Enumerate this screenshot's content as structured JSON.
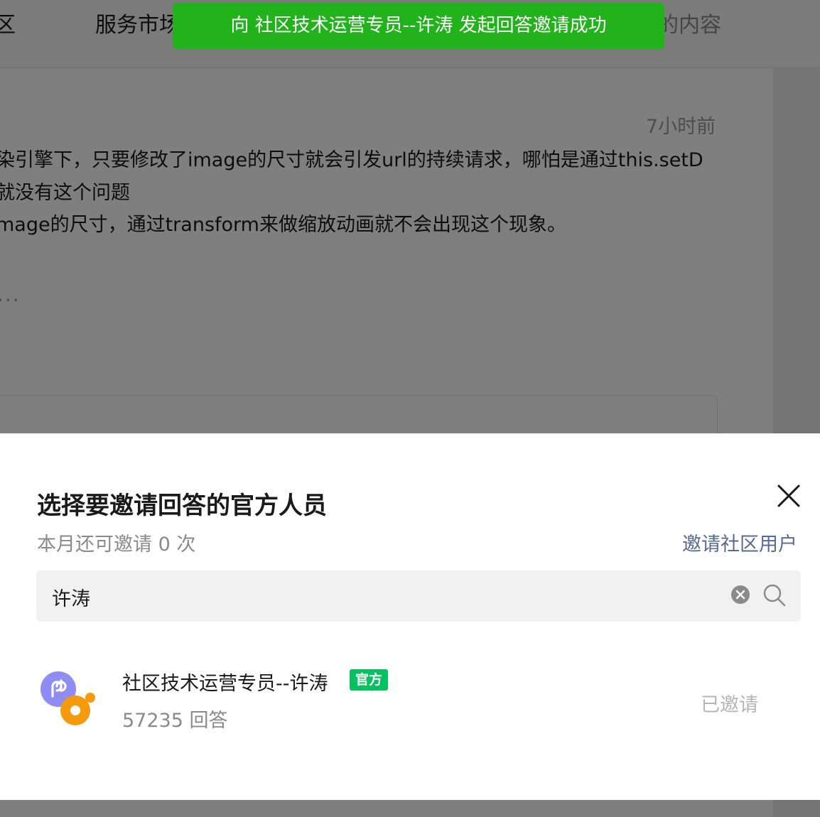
{
  "topbar": {
    "nav_left": "区",
    "nav_market": "服务市场",
    "nav_right": "的内容"
  },
  "post": {
    "timestamp": "7小时前",
    "lines": [
      "染引擎下，只要修改了image的尺寸就会引发url的持续请求，哪怕是通过this.setD",
      "就没有这个问题",
      "mage的尺寸，通过transform来做缩放动画就不会出现这个现象。"
    ],
    "more": "..."
  },
  "toast": {
    "message": "向 社区技术运营专员--许涛 发起回答邀请成功",
    "color": "#21b21c"
  },
  "sheet": {
    "title": "选择要邀请回答的官方人员",
    "quota": "本月还可邀请 0 次",
    "invite_community_label": "邀请社区用户",
    "close_icon": "close-icon",
    "search": {
      "value": "许涛",
      "clear_icon": "clear-icon",
      "search_icon": "search-icon"
    },
    "results": [
      {
        "name": "社区技术运营专员--许涛",
        "badge": "官方",
        "answers": "57235 回答",
        "status": "已邀请",
        "avatar_icon": "mini-program-logo"
      }
    ]
  },
  "colors": {
    "accent_link": "#576b95",
    "official_badge": "#07c160",
    "toast_bg": "#21b21c"
  }
}
